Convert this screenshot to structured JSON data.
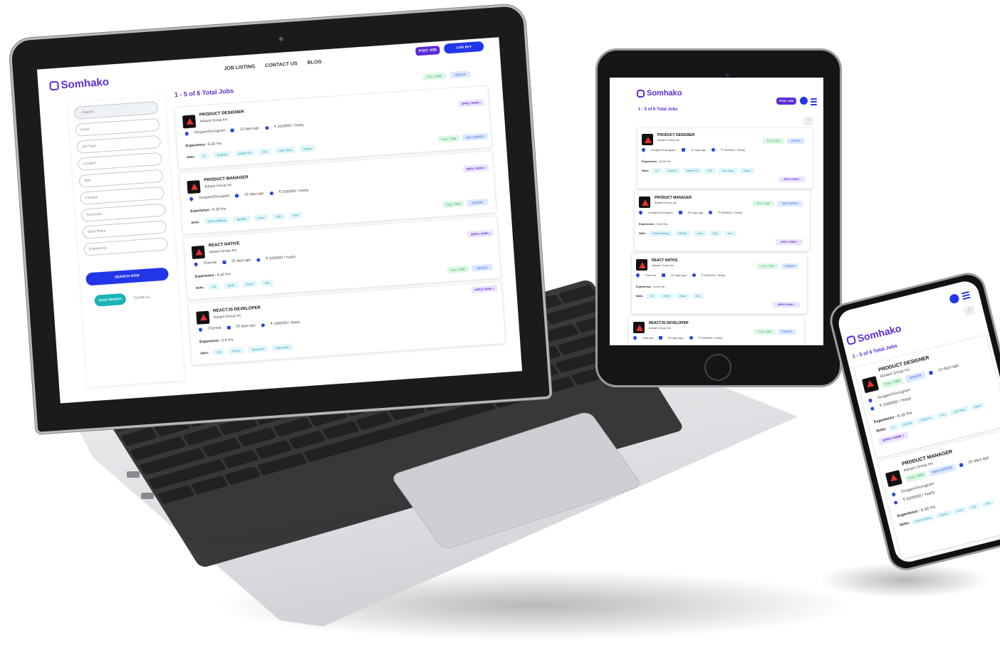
{
  "brand": {
    "name": "Somhako",
    "accent": "#5b2bd6",
    "primary_blue": "#2136e8",
    "tag_green": "#3aa55a",
    "tag_blue": "#3a62d8",
    "skill_teal": "#1f93b3"
  },
  "laptop": {
    "nav": {
      "job_listing": "JOB LISTING",
      "contact_us": "CONTACT US",
      "blog": "BLOG"
    },
    "post_job": "POST JOB",
    "log_in": "LOG IN",
    "results_title": "1 - 5 of 6 Total Jobs",
    "filters": {
      "search_placeholder": "Search",
      "level": "Level",
      "job_type": "Job Type",
      "location": "Location",
      "skill": "Skill",
      "industry": "Industry",
      "functions": "Functions",
      "work_place": "Work Place",
      "experience": "Experience"
    },
    "search_now": "SEARCH NOW",
    "save_search": "SAVE SEARCH",
    "clear_all": "CLEAR ALL",
    "top_tags": {
      "full_time": "FULL TIME",
      "senior": "SENIOR"
    },
    "jobs": [
      {
        "title": "PRODUCT DESIGNER",
        "company": "Advant Group Inc",
        "location": "Gurgaon/Gurugram",
        "posted": "13 days ago",
        "salary": "₹ 2500000 / Yearly",
        "experience_label": "Experience -",
        "experience": "5-10 Yrs",
        "skills_label": "Skills:",
        "skills": [
          "UI",
          "Android",
          "Adobe XD",
          "iOS",
          "User Story",
          "Figma"
        ],
        "tag1": "FULL TIME",
        "tag2": "MID CARRER",
        "apply": "APPLY NOW »"
      },
      {
        "title": "PRODUCT MANAGER",
        "company": "Advant Group Inc",
        "location": "Gurgaon/Gurugram",
        "posted": "25 days ago",
        "salary": "₹ 5500000 / Yearly",
        "experience_label": "Experience -",
        "experience": "5-10 Yrs",
        "skills_label": "Skills:",
        "skills": [
          "Shell Scripting",
          "MySQL",
          "Linux",
          "SQL",
          "Unix"
        ],
        "tag1": "FULL TIME",
        "tag2": "SENIOR",
        "apply": "APPLY NOW »"
      },
      {
        "title": "REACT NATIVE",
        "company": "Advant Group Inc",
        "location": "Chennai",
        "posted": "25 days ago",
        "salary": "₹ 2000000 / Yearly",
        "experience_label": "Experience -",
        "experience": "5-10 Yrs",
        "skills_label": "Skills:",
        "skills": [
          "Git",
          "JSON",
          "Azure",
          "Jira"
        ],
        "tag1": "FULL TIME",
        "tag2": "SENIOR",
        "apply": "APPLY NOW »"
      },
      {
        "title": "REACTJS DEVELOPER",
        "company": "Advant Group Inc",
        "location": "Chennai",
        "posted": "25 days ago",
        "salary": "₹ 2000000 / Yearly",
        "experience_label": "Experience -",
        "experience": "2-4 Yrs",
        "skills_label": "Skills:",
        "skills": [
          "Jira",
          "Azure",
          "Javascript",
          "TypeScript"
        ],
        "apply": "APPLY NOW »"
      }
    ]
  },
  "tablet": {
    "post_job": "POST JOB",
    "results_title": "1 - 5 of 6 Total Jobs",
    "jobs": [
      {
        "title": "PRODUCT DESIGNER",
        "company": "Advant Group Inc",
        "location": "Gurgaon/Gurugram",
        "posted": "12 days ago",
        "salary": "₹ 2500000 / Yearly",
        "experience_label": "Experience -",
        "experience": "5-10 Yrs",
        "skills_label": "Skills:",
        "skills": [
          "UI",
          "Android",
          "Adobe XD",
          "iOS",
          "User Story",
          "Figma"
        ],
        "tag1": "FULL TIME",
        "tag2": "SENIOR",
        "apply": "APPLY NOW »"
      },
      {
        "title": "PRODUCT MANAGER",
        "company": "Advant Group Inc",
        "location": "Gurgaon/Gurugram",
        "posted": "25 days ago",
        "salary": "₹ 5500000 / Yearly",
        "experience_label": "Experience -",
        "experience": "5-10 Yrs",
        "skills_label": "Skills:",
        "skills": [
          "Shell Scripting",
          "MySQL",
          "Linux",
          "SQL",
          "Unix"
        ],
        "tag1": "FULL TIME",
        "tag2": "MID CARRER",
        "apply": "APPLY NOW »"
      },
      {
        "title": "REACT NATIVE",
        "company": "Advant Group Inc",
        "location": "Chennai",
        "posted": "25 days ago",
        "salary": "₹ 2000000 / Yearly",
        "experience_label": "Experience -",
        "experience": "5-10 Yrs",
        "skills_label": "Skills:",
        "skills": [
          "Git",
          "JSON",
          "Azure",
          "Jira"
        ],
        "tag1": "FULL TIME",
        "tag2": "SENIOR",
        "apply": "APPLY NOW »"
      },
      {
        "title": "REACTJS DEVELOPER",
        "company": "Advant Group Inc",
        "location": "Chennai",
        "posted": "25 days ago",
        "salary": "₹ 2000000 / Yearly",
        "tag1": "FULL TIME",
        "tag2": "SENIOR"
      }
    ]
  },
  "phone": {
    "results_title": "1 - 5 of 6 Total Jobs",
    "jobs": [
      {
        "title": "PRODUCT DESIGNER",
        "company": "Advant Group Inc",
        "tag1": "FULL TIME",
        "tag2": "SENIOR",
        "posted": "13 days ago",
        "location": "Gurgaon/Gurugram",
        "salary": "₹ 2500000 / Yearly",
        "experience_label": "Experience -",
        "experience": "5-10 Yrs",
        "skills_label": "Skills:",
        "skills": [
          "UI",
          "Android",
          "Adobe XD",
          "iOS",
          "User Story",
          "Figma"
        ],
        "apply": "APPLY NOW »"
      },
      {
        "title": "PRODUCT MANAGER",
        "company": "Advant Group Inc",
        "tag1": "FULL TIME",
        "tag2": "MID CARRER",
        "posted": "25 days ago",
        "location": "Gurgaon/Gurugram",
        "salary": "₹ 5500000 / Yearly",
        "experience_label": "Experience -",
        "experience": "5-10 Yrs",
        "skills_label": "Skills:",
        "skills": [
          "Shell Scripting",
          "MySQL",
          "Linux",
          "SQL",
          "Unix"
        ]
      }
    ]
  }
}
